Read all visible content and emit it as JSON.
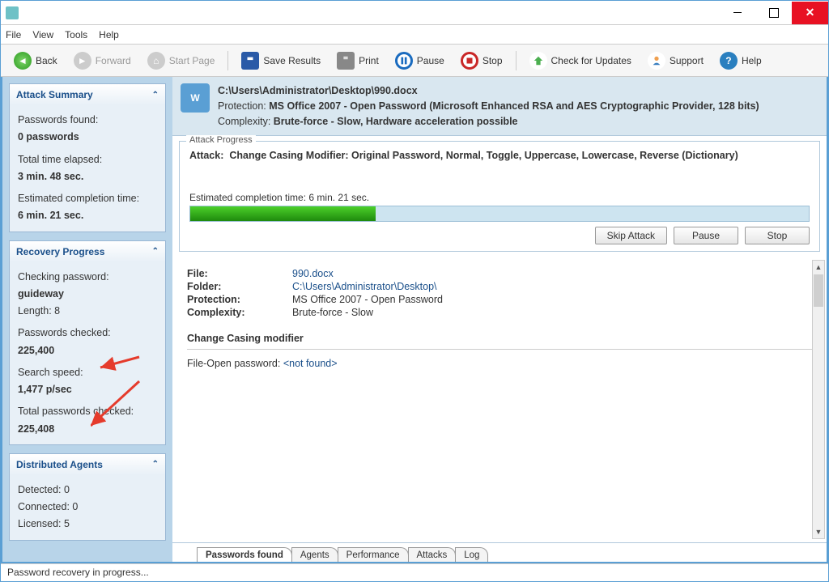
{
  "menu": {
    "file": "File",
    "view": "View",
    "tools": "Tools",
    "help": "Help"
  },
  "toolbar": {
    "back": "Back",
    "forward": "Forward",
    "start_page": "Start Page",
    "save_results": "Save Results",
    "print": "Print",
    "pause": "Pause",
    "stop": "Stop",
    "check_updates": "Check for Updates",
    "support": "Support",
    "help": "Help"
  },
  "sidebar": {
    "attack_summary": {
      "title": "Attack Summary",
      "pw_found_label": "Passwords found:",
      "pw_found_value": "0 passwords",
      "time_elapsed_label": "Total time elapsed:",
      "time_elapsed_value": "3 min. 48 sec.",
      "est_label": "Estimated completion time:",
      "est_value": "6 min. 21 sec."
    },
    "recovery_progress": {
      "title": "Recovery Progress",
      "checking_label": "Checking password:",
      "checking_value": "guideway",
      "length_label": "Length: 8",
      "checked_label": "Passwords checked:",
      "checked_value": "225,400",
      "speed_label": "Search speed:",
      "speed_value": "1,477 p/sec",
      "total_label": "Total passwords checked:",
      "total_value": "225,408"
    },
    "agents": {
      "title": "Distributed Agents",
      "detected": "Detected: 0",
      "connected": "Connected: 0",
      "licensed": "Licensed: 5"
    }
  },
  "file_header": {
    "path": "C:\\Users\\Administrator\\Desktop\\990.docx",
    "protection_label": "Protection: ",
    "protection_value": "MS Office 2007 - Open Password (Microsoft Enhanced RSA and AES Cryptographic Provider, 128 bits)",
    "complexity_label": "Complexity: ",
    "complexity_value": "Brute-force - Slow, Hardware acceleration possible"
  },
  "attack_progress": {
    "legend": "Attack Progress",
    "attack_label": "Attack:",
    "attack_value": "Change Casing Modifier: Original Password, Normal, Toggle, Uppercase, Lowercase, Reverse (Dictionary)",
    "est_label": "Estimated completion time: 6 min. 21 sec.",
    "progress_pct": 30,
    "btn_skip": "Skip Attack",
    "btn_pause": "Pause",
    "btn_stop": "Stop"
  },
  "details": {
    "file_k": "File:",
    "file_v": "990.docx",
    "folder_k": "Folder:",
    "folder_v": "C:\\Users\\Administrator\\Desktop\\",
    "protection_k": "Protection:",
    "protection_v": "MS Office 2007 - Open Password",
    "complexity_k": "Complexity:",
    "complexity_v": "Brute-force - Slow",
    "section": "Change Casing modifier",
    "fopen_label": "File-Open password: ",
    "fopen_value": "<not found>"
  },
  "tabs": {
    "passwords_found": "Passwords found",
    "agents": "Agents",
    "performance": "Performance",
    "attacks": "Attacks",
    "log": "Log"
  },
  "status": "Password recovery in progress..."
}
